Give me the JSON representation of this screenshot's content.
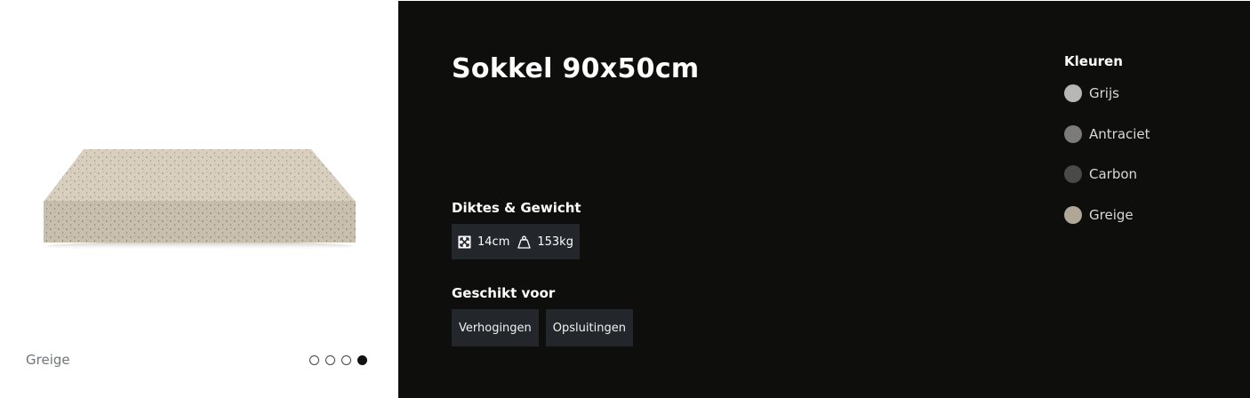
{
  "gallery": {
    "caption": "Greige",
    "dots_total": 4,
    "dots_active_index": 3
  },
  "product": {
    "title": "Sokkel 90x50cm",
    "diktes_label": "Diktes & Gewicht",
    "thickness": "14cm",
    "weight": "153kg",
    "geschikt_label": "Geschikt voor",
    "uses": [
      "Verhogingen",
      "Opsluitingen"
    ]
  },
  "colors": {
    "title": "Kleuren",
    "items": [
      {
        "name": "Grijs",
        "hex": "#b8b7b8"
      },
      {
        "name": "Antraciet",
        "hex": "#7c7b79"
      },
      {
        "name": "Carbon",
        "hex": "#4a4a49"
      },
      {
        "name": "Greige",
        "hex": "#b0a797"
      }
    ]
  }
}
